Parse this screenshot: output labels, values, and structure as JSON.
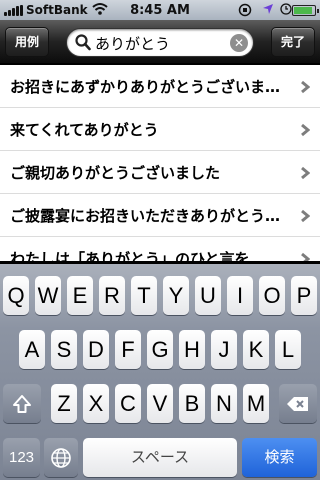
{
  "status_bar": {
    "carrier": "SoftBank",
    "time": "8:45 AM",
    "icons": [
      "signal-icon",
      "wifi-icon",
      "orientation-lock-icon",
      "location-icon",
      "alarm-icon",
      "battery-icon"
    ]
  },
  "toolbar": {
    "left_label": "用例",
    "right_label": "完了",
    "search_value": "ありがとう"
  },
  "results": [
    "お招きにあずかりありがとうございました",
    "来てくれてありがとう",
    "ご親切ありがとうございました",
    "ご披露宴にお招きいただきありがとうございました",
    "わたしは「ありがとう」のひと言を"
  ],
  "keyboard": {
    "row1": [
      "Q",
      "W",
      "E",
      "R",
      "T",
      "Y",
      "U",
      "I",
      "O",
      "P"
    ],
    "row2": [
      "A",
      "S",
      "D",
      "F",
      "G",
      "H",
      "J",
      "K",
      "L"
    ],
    "row3": [
      "Z",
      "X",
      "C",
      "V",
      "B",
      "N",
      "M"
    ],
    "numbers_label": "123",
    "space_label": "スペース",
    "search_label": "検索",
    "icons": [
      "shift-icon",
      "backspace-icon",
      "globe-icon"
    ]
  },
  "colors": {
    "toolbar": "#1a1a1a",
    "search_key": "#2a6fe0",
    "keyboard_bg": "#8a92a1"
  }
}
